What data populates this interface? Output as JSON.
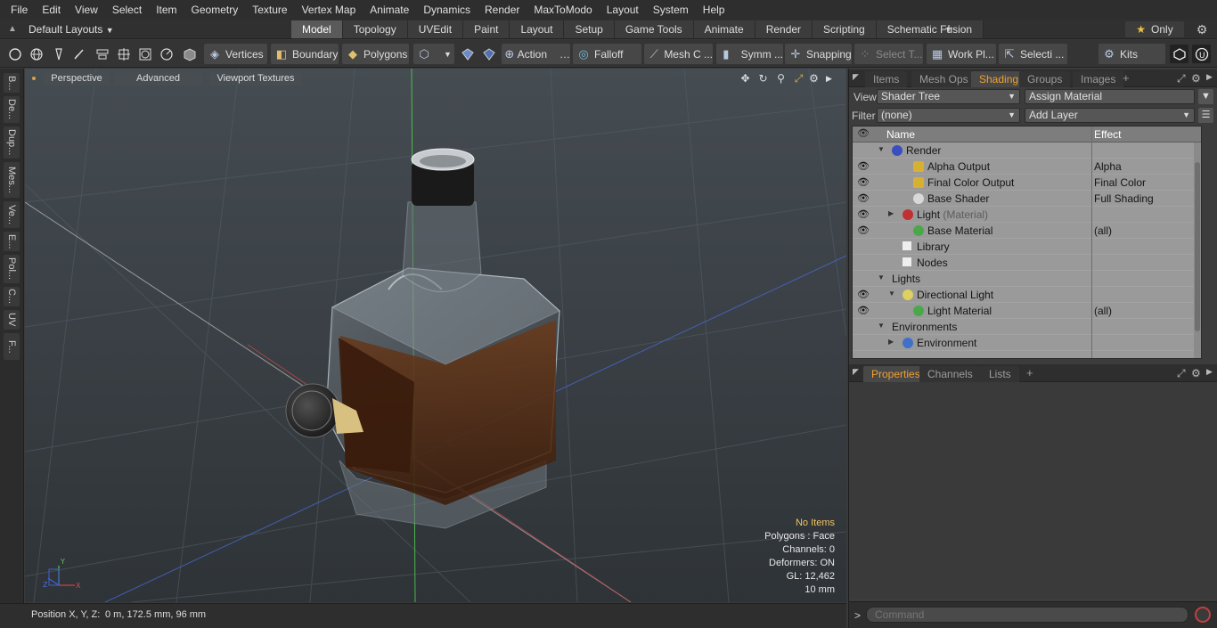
{
  "menubar": {
    "items": [
      "File",
      "Edit",
      "View",
      "Select",
      "Item",
      "Geometry",
      "Texture",
      "Vertex Map",
      "Animate",
      "Dynamics",
      "Render",
      "MaxToModo",
      "Layout",
      "System",
      "Help"
    ]
  },
  "layoutbar": {
    "layout_select": "Default Layouts",
    "tabs": [
      "Model",
      "Topology",
      "UVEdit",
      "Paint",
      "Layout",
      "Setup",
      "Game Tools",
      "Animate",
      "Render",
      "Scripting",
      "Schematic Fusion"
    ],
    "active_tab": "Model",
    "only_label": "Only"
  },
  "toolbar": {
    "vertices": "Vertices",
    "boundary": "Boundary",
    "polygons": "Polygons",
    "action": "Action",
    "falloff": "Falloff",
    "mesh_c": "Mesh C ...",
    "symm": "Symm ...",
    "snapping": "Snapping",
    "select_t": "Select T...",
    "work_pl": "Work Pl...",
    "selecti": "Selecti ...",
    "kits": "Kits"
  },
  "leftstrip": {
    "tabs": [
      "B...",
      "De...",
      "Dup...",
      "Mes...",
      "Ve...",
      "E...",
      "Pol...",
      "C...",
      "UV",
      "F..."
    ]
  },
  "viewport": {
    "tabs": [
      "Perspective",
      "Advanced",
      "Viewport Textures"
    ],
    "info": {
      "selection": "No Items",
      "polygons": "Polygons : Face",
      "channels": "Channels: 0",
      "deformers": "Deformers: ON",
      "gl": "GL: 12,462",
      "scale": "10 mm"
    },
    "axes": {
      "x": "X",
      "y": "Y",
      "z": "Z"
    }
  },
  "statusbar": {
    "position_label": "Position X, Y, Z:",
    "position_value": "0 m, 172.5 mm, 96 mm"
  },
  "shading_panel": {
    "tabs": [
      "Items",
      "Mesh Ops",
      "Shading",
      "Groups",
      "Images"
    ],
    "active_tab": "Shading",
    "view_label": "View",
    "view_value": "Shader Tree",
    "assign_material": "Assign Material",
    "filter_label": "Filter",
    "filter_value": "(none)",
    "add_layer": "Add Layer",
    "columns": {
      "name": "Name",
      "effect": "Effect"
    },
    "rows": [
      {
        "name": "Render",
        "effect": "",
        "muted": "",
        "indent": 0,
        "twist": "open",
        "icon": "render-sphere-icon",
        "color": "#3a4ec0",
        "eye": false
      },
      {
        "name": "Alpha Output",
        "effect": "Alpha",
        "muted": "",
        "indent": 2,
        "twist": "",
        "icon": "output-icon",
        "color": "#d8b030",
        "eye": true
      },
      {
        "name": "Final Color Output",
        "effect": "Final Color",
        "muted": "",
        "indent": 2,
        "twist": "",
        "icon": "output-icon",
        "color": "#d8b030",
        "eye": true
      },
      {
        "name": "Base Shader",
        "effect": "Full Shading",
        "muted": "",
        "indent": 2,
        "twist": "",
        "icon": "shader-sphere-icon",
        "color": "#d8d8d8",
        "eye": true
      },
      {
        "name": "Light",
        "effect": "",
        "muted": "(Material)",
        "indent": 1,
        "twist": "closed",
        "icon": "material-sphere-icon",
        "color": "#c03030",
        "eye": true
      },
      {
        "name": "Base Material",
        "effect": "(all)",
        "muted": "",
        "indent": 2,
        "twist": "",
        "icon": "material-sphere-icon",
        "color": "#4aa84a",
        "eye": true
      },
      {
        "name": "Library",
        "effect": "",
        "muted": "",
        "indent": 1,
        "twist": "",
        "icon": "folder-icon",
        "color": "#e8e8e8",
        "eye": false
      },
      {
        "name": "Nodes",
        "effect": "",
        "muted": "",
        "indent": 1,
        "twist": "",
        "icon": "folder-icon",
        "color": "#e8e8e8",
        "eye": false
      },
      {
        "name": "Lights",
        "effect": "",
        "muted": "",
        "indent": 0,
        "twist": "open",
        "icon": "",
        "color": "",
        "eye": false
      },
      {
        "name": "Directional Light",
        "effect": "",
        "muted": "",
        "indent": 1,
        "twist": "open",
        "icon": "light-icon",
        "color": "#e0d060",
        "eye": true
      },
      {
        "name": "Light Material",
        "effect": "(all)",
        "muted": "",
        "indent": 2,
        "twist": "",
        "icon": "material-sphere-icon",
        "color": "#4aa84a",
        "eye": true
      },
      {
        "name": "Environments",
        "effect": "",
        "muted": "",
        "indent": 0,
        "twist": "open",
        "icon": "",
        "color": "",
        "eye": false
      },
      {
        "name": "Environment",
        "effect": "",
        "muted": "",
        "indent": 1,
        "twist": "closed",
        "icon": "environment-icon",
        "color": "#4070c8",
        "eye": false
      }
    ]
  },
  "properties_panel": {
    "tabs": [
      "Properties",
      "Channels",
      "Lists"
    ],
    "active_tab": "Properties"
  },
  "command": {
    "placeholder": "Command",
    "prompt": ">"
  },
  "colors": {
    "accent": "#f0a030",
    "info_highlight": "#f2c55c",
    "viewport_bg": "#3a4146"
  }
}
